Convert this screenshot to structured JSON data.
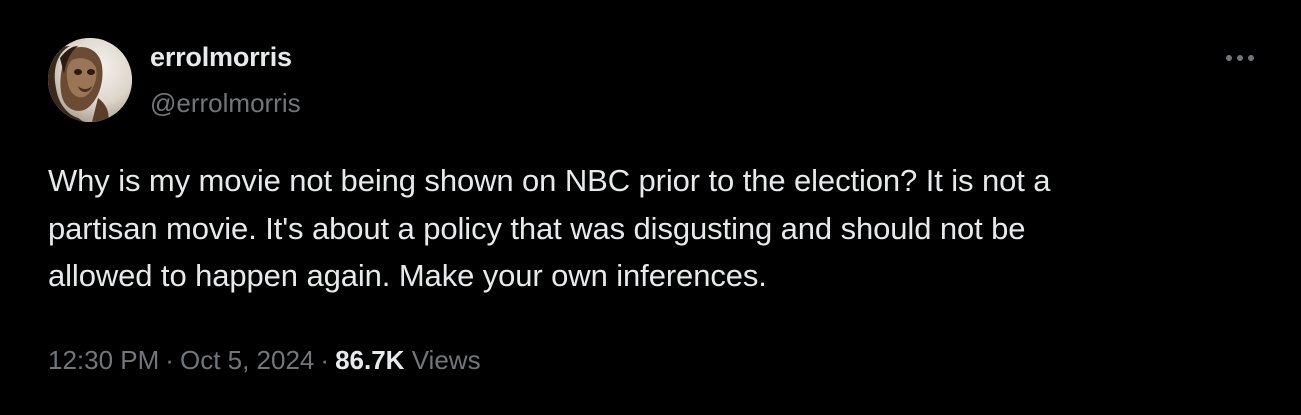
{
  "author": {
    "display_name": "errolmorris",
    "handle": "@errolmorris"
  },
  "tweet": {
    "text": "Why is my movie not being shown on NBC prior to the election? It is not a\npartisan movie. It's about a policy that was disgusting and should not be\nallowed to happen again. Make your own inferences."
  },
  "meta": {
    "time": "12:30 PM",
    "separator": "·",
    "date": "Oct 5, 2024",
    "views_count": "86.7K",
    "views_label": "Views"
  },
  "icons": {
    "more": "more-horizontal-icon",
    "avatar": "profile-avatar"
  },
  "colors": {
    "background": "#000000",
    "primary_text": "#e7e9ea",
    "secondary_text": "#71767b"
  }
}
